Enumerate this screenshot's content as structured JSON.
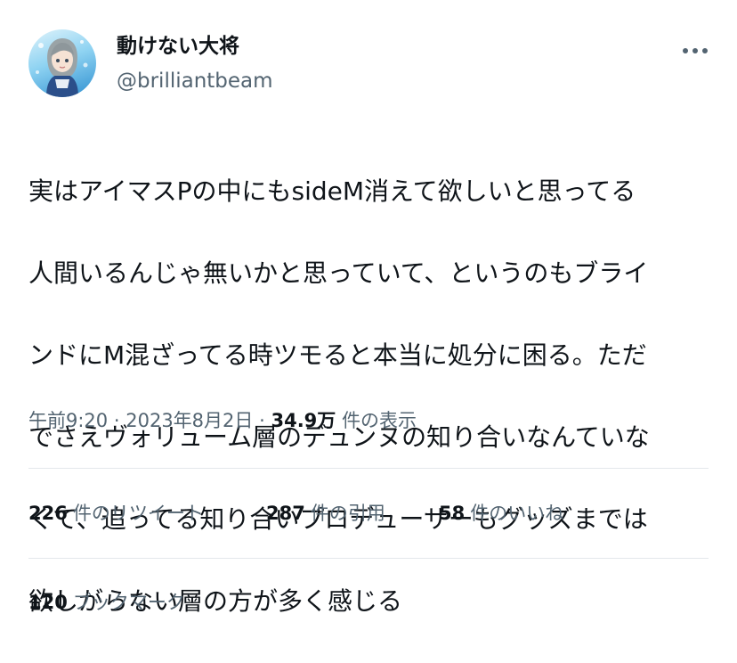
{
  "author": {
    "display_name": "動けない大将",
    "handle": "@brilliantbeam"
  },
  "tweet": {
    "lines": [
      "実はアイマスPの中にもsideM消えて欲しいと思ってる",
      "人間いるんじゃ無いかと思っていて、というのもブライ",
      "ンドにM混ざってる時ツモると本当に処分に困る。ただ",
      "でさえヴォリューム層のデュンヌの知り合いなんていな",
      "くて、追ってる知り合いプロデューサーもグッズまでは",
      "欲しがらない層の方が多く感じる"
    ]
  },
  "meta": {
    "time": "午前9:20",
    "date": "2023年8月2日",
    "separator": "·",
    "views_count": "34.9万",
    "views_label": "件の表示"
  },
  "stats": {
    "retweets": {
      "count": "226",
      "label": "件のリツイート"
    },
    "quotes": {
      "count": "287",
      "label": "件の引用"
    },
    "likes": {
      "count": "58",
      "label": "件のいいね"
    },
    "bookmarks": {
      "count": "120",
      "label": "ブックマーク"
    }
  },
  "icons": {
    "more": "more-horizontal-icon",
    "avatar": "user-avatar"
  },
  "colors": {
    "text_primary": "#0f1419",
    "text_secondary": "#536471",
    "divider": "#e4e8eb"
  }
}
